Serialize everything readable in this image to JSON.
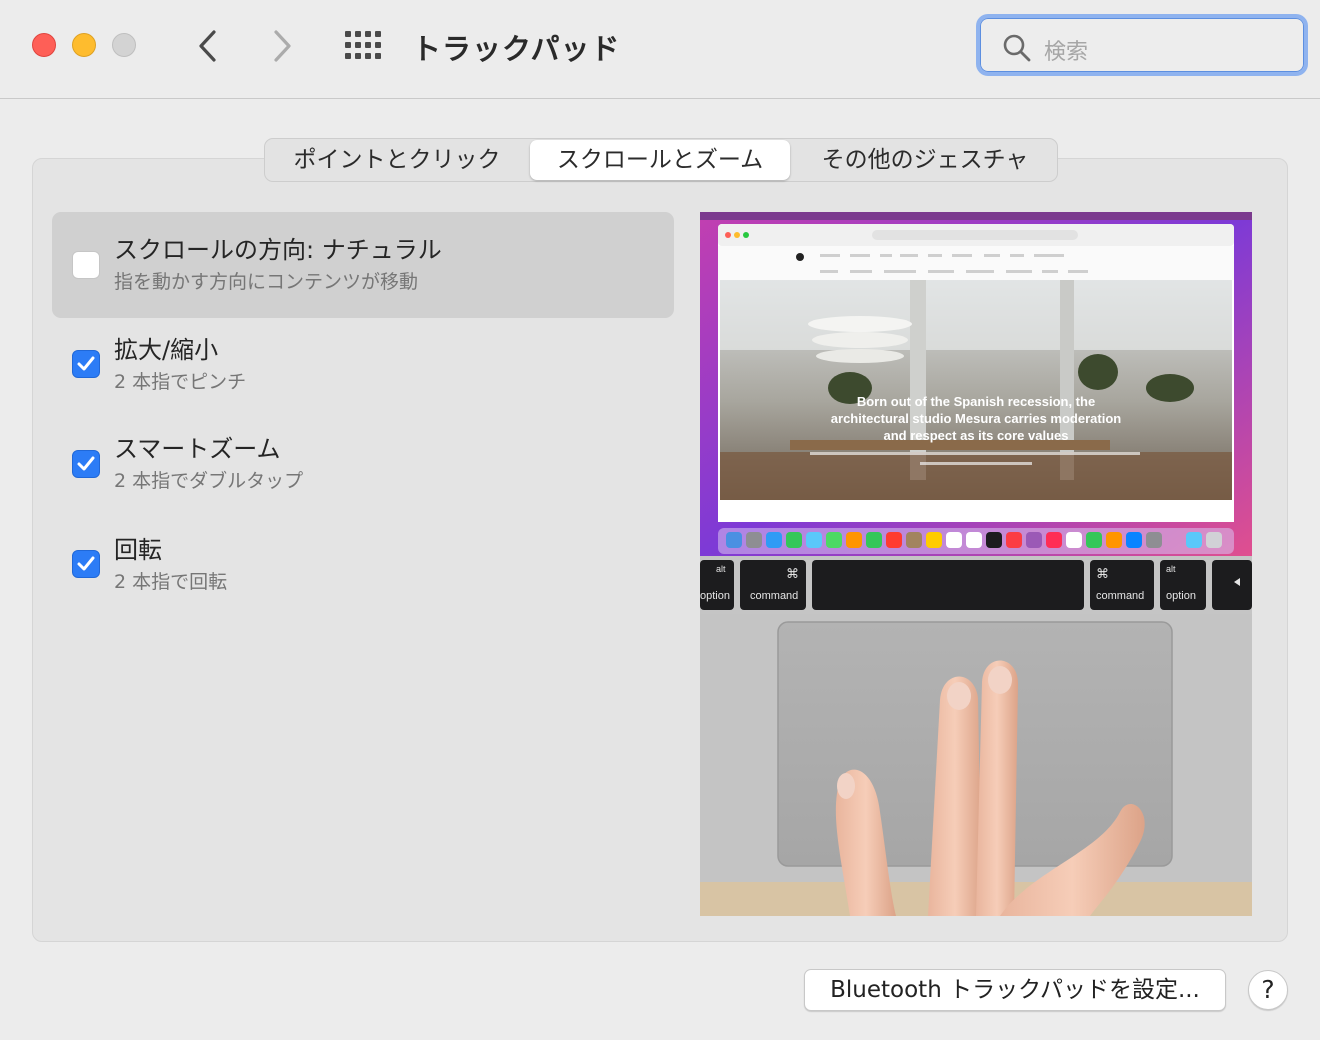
{
  "window": {
    "title": "トラックパッド",
    "search_placeholder": "検索"
  },
  "tabs": [
    {
      "label": "ポイントとクリック",
      "selected": false
    },
    {
      "label": "スクロールとズーム",
      "selected": true
    },
    {
      "label": "その他のジェスチャ",
      "selected": false
    }
  ],
  "options": [
    {
      "label": "スクロールの方向: ナチュラル",
      "sub": "指を動かす方向にコンテンツが移動",
      "checked": false
    },
    {
      "label": "拡大/縮小",
      "sub": "2 本指でピンチ",
      "checked": true
    },
    {
      "label": "スマートズーム",
      "sub": "2 本指でダブルタップ",
      "checked": true
    },
    {
      "label": "回転",
      "sub": "2 本指で回転",
      "checked": true
    }
  ],
  "preview": {
    "headline_lines": [
      "Born out of the Spanish recession, the",
      "architectural studio Mesura carries moderation",
      "and respect as its core values"
    ],
    "keys": {
      "alt_left": "alt",
      "option_left": "option",
      "command_left": "command",
      "cmd_symbol": "⌘",
      "command_right": "command",
      "alt_right": "alt",
      "option_right": "option"
    }
  },
  "bottom": {
    "bluetooth_button": "Bluetooth トラックパッドを設定...",
    "help": "?"
  },
  "colors": {
    "accent": "#2c7cf6",
    "close": "#fe5f57",
    "minimize": "#febc2e"
  }
}
